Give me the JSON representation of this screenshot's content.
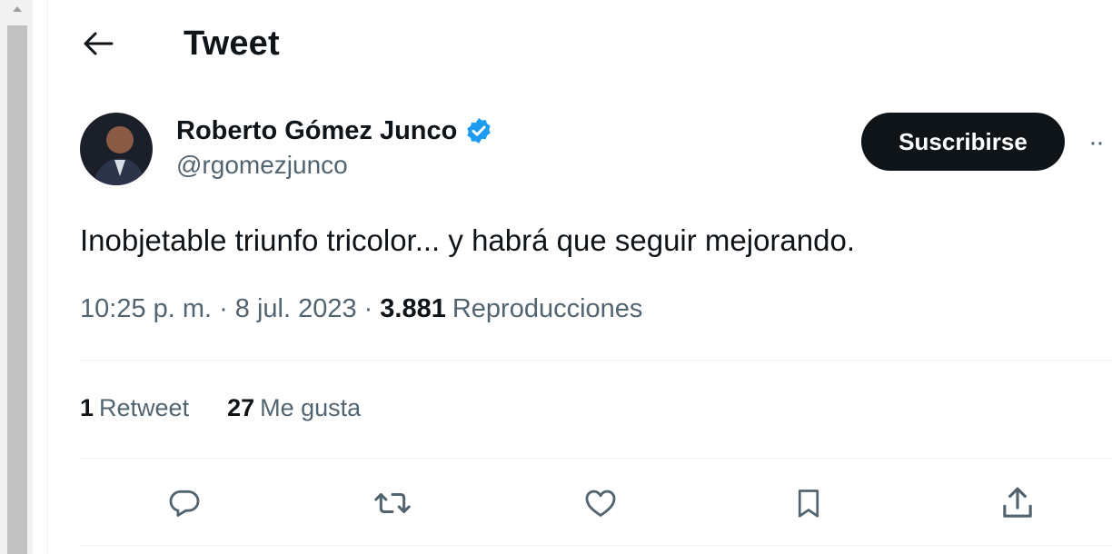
{
  "header": {
    "title": "Tweet"
  },
  "author": {
    "name": "Roberto Gómez Junco",
    "handle": "@rgomezjunco",
    "verified": true
  },
  "subscribe_label": "Suscribirse",
  "more_label": "··",
  "tweet": {
    "text": "Inobjetable triunfo tricolor... y habrá que seguir mejorando.",
    "time": "10:25 p. m.",
    "date": "8 jul. 2023",
    "views_count": "3.881",
    "views_label": "Reproducciones"
  },
  "stats": {
    "retweets_count": "1",
    "retweets_label": "Retweet",
    "likes_count": "27",
    "likes_label": "Me gusta"
  },
  "colors": {
    "accent": "#1d9bf0",
    "text_primary": "#0f1419",
    "text_secondary": "#536471",
    "button_dark": "#0f1419"
  },
  "icons": [
    "back-arrow-icon",
    "verified-badge-icon",
    "reply-icon",
    "retweet-icon",
    "like-icon",
    "bookmark-icon",
    "share-icon"
  ]
}
